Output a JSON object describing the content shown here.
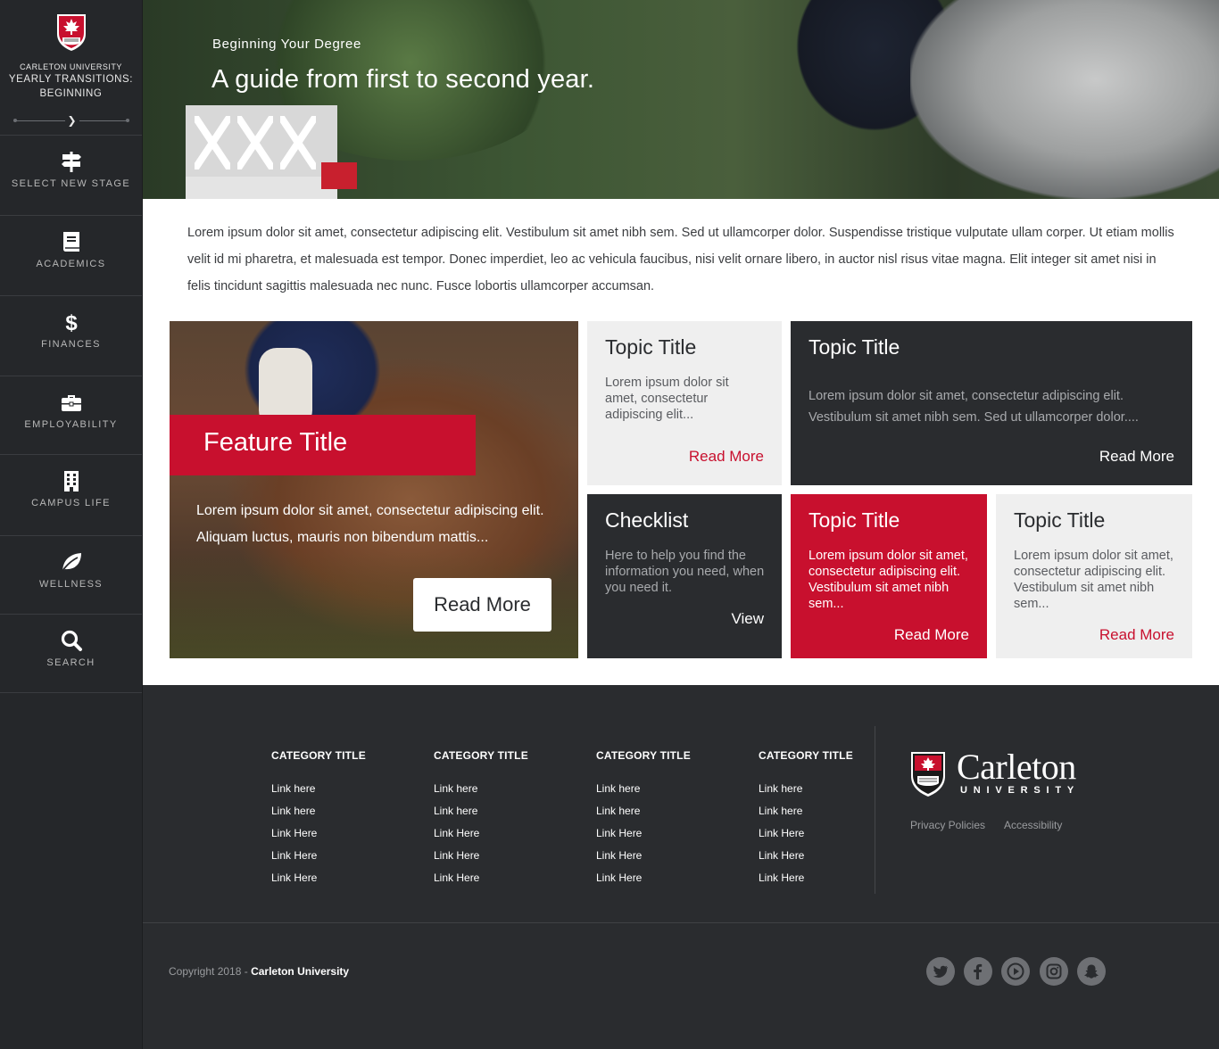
{
  "sidebar": {
    "university": "CARLETON UNIVERSITY",
    "title_line1": "YEARLY TRANSITIONS:",
    "title_line2": "BEGINNING",
    "items": [
      {
        "label": "SELECT NEW STAGE",
        "icon": "signpost-icon"
      },
      {
        "label": "ACADEMICS",
        "icon": "book-icon"
      },
      {
        "label": "FINANCES",
        "icon": "dollar-icon"
      },
      {
        "label": "EMPLOYABILITY",
        "icon": "briefcase-icon"
      },
      {
        "label": "CAMPUS LIFE",
        "icon": "building-icon"
      },
      {
        "label": "WELLNESS",
        "icon": "leaf-icon"
      },
      {
        "label": "SEARCH",
        "icon": "search-icon"
      }
    ]
  },
  "hero": {
    "subtitle": "Beginning Your Degree",
    "title": "A guide from first to second year."
  },
  "intro": "Lorem ipsum dolor sit amet, consectetur adipiscing elit. Vestibulum sit amet nibh sem. Sed ut ullamcorper dolor. Suspendisse tristique vulputate ullam corper.  Ut etiam mollis velit id mi pharetra, et malesuada est tempor. Donec imperdiet, leo ac vehicula faucibus, nisi velit ornare libero, in auctor nisl risus vitae magna. Elit integer sit amet nisi in felis tincidunt sagittis malesuada nec nunc. Fusce lobortis ullamcorper accumsan.",
  "feature": {
    "title": "Feature Title",
    "text": "Lorem ipsum dolor sit amet, consectetur adipiscing elit. Aliquam luctus, mauris non bibendum mattis...",
    "button": "Read More"
  },
  "cards": {
    "c1": {
      "title": "Topic Title",
      "text": "Lorem ipsum dolor sit amet, consectetur adipiscing elit...",
      "link": "Read More"
    },
    "c2": {
      "title": "Topic Title",
      "text": "Lorem ipsum dolor sit amet, consectetur adipiscing elit. Vestibulum sit amet nibh sem. Sed ut ullamcorper dolor....",
      "link": "Read More"
    },
    "c3": {
      "title": "Checklist",
      "text": "Here to help you find the information you need, when you need it.",
      "link": "View"
    },
    "c4": {
      "title": "Topic Title",
      "text": "Lorem ipsum dolor sit amet, consectetur adipiscing elit. Vestibulum sit amet nibh sem...",
      "link": "Read More"
    },
    "c5": {
      "title": "Topic Title",
      "text": "Lorem ipsum dolor sit amet, consectetur adipiscing elit. Vestibulum sit amet nibh sem...",
      "link": "Read More"
    }
  },
  "footer": {
    "columns": [
      {
        "title": "CATEGORY TITLE",
        "links": [
          "Link here",
          "Link here",
          "Link Here",
          "Link Here",
          "Link Here"
        ]
      },
      {
        "title": "CATEGORY TITLE",
        "links": [
          "Link here",
          "Link here",
          "Link Here",
          "Link Here",
          "Link Here"
        ]
      },
      {
        "title": "CATEGORY TITLE",
        "links": [
          "Link here",
          "Link here",
          "Link Here",
          "Link Here",
          "Link Here"
        ]
      },
      {
        "title": "CATEGORY TITLE",
        "links": [
          "Link here",
          "Link here",
          "Link Here",
          "Link Here",
          "Link Here"
        ]
      }
    ],
    "logo_name": "Carleton",
    "logo_uni": "UNIVERSITY",
    "privacy": "Privacy Policies",
    "accessibility": "Accessibility",
    "copyright_prefix": "Copyright 2018 - ",
    "copyright_name": "Carleton University",
    "social": [
      "twitter-icon",
      "facebook-icon",
      "youtube-icon",
      "instagram-icon",
      "snapchat-icon"
    ]
  },
  "colors": {
    "accent": "#c8102e",
    "dark": "#2a2c2f",
    "light": "#efefef"
  }
}
